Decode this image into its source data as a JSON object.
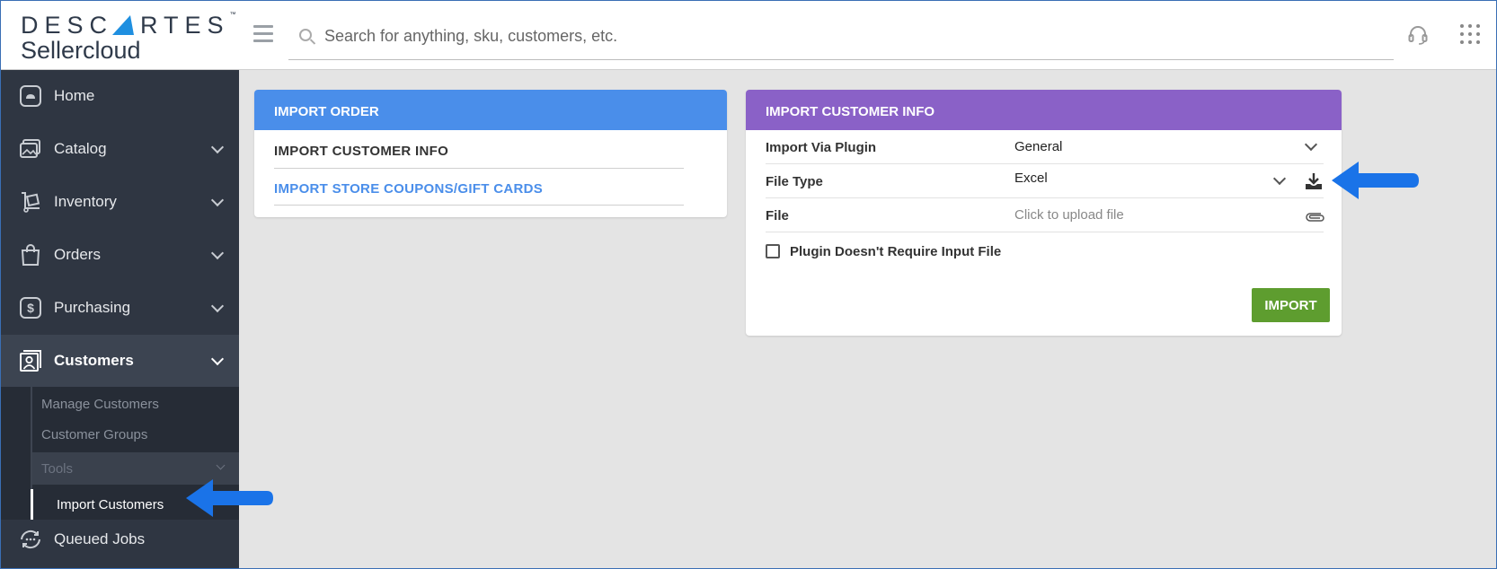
{
  "header": {
    "logo_top": "DESC",
    "logo_top_rest": "RTES",
    "logo_tm": "™",
    "logo_bottom": "Sellercloud",
    "search_placeholder": "Search for anything, sku, customers, etc."
  },
  "sidebar": {
    "items": [
      {
        "label": "Home",
        "icon": "home-icon"
      },
      {
        "label": "Catalog",
        "icon": "catalog-icon"
      },
      {
        "label": "Inventory",
        "icon": "inventory-icon"
      },
      {
        "label": "Orders",
        "icon": "orders-icon"
      },
      {
        "label": "Purchasing",
        "icon": "purchasing-icon"
      },
      {
        "label": "Customers",
        "icon": "customers-icon"
      },
      {
        "label": "Queued Jobs",
        "icon": "queued-jobs-icon"
      }
    ],
    "sub_items": [
      "Manage Customers",
      "Customer Groups",
      "Tools",
      "Import Customers"
    ]
  },
  "import_order_card": {
    "title": "IMPORT ORDER",
    "links": [
      "IMPORT CUSTOMER INFO",
      "IMPORT STORE COUPONS/GIFT CARDS"
    ]
  },
  "import_customer_card": {
    "title": "IMPORT CUSTOMER INFO",
    "fields": [
      {
        "label": "Import Via Plugin",
        "value": "General"
      },
      {
        "label": "File Type",
        "value": "Excel"
      },
      {
        "label": "File",
        "value": "Click to upload file"
      }
    ],
    "checkbox_label": "Plugin Doesn't Require Input File",
    "button_label": "IMPORT"
  },
  "colors": {
    "sidebar_bg": "#2f3642",
    "import_order_header": "#4a8eea",
    "import_customer_header": "#8a61c7",
    "import_button": "#5e9d2f",
    "arrow": "#1a73e8"
  }
}
